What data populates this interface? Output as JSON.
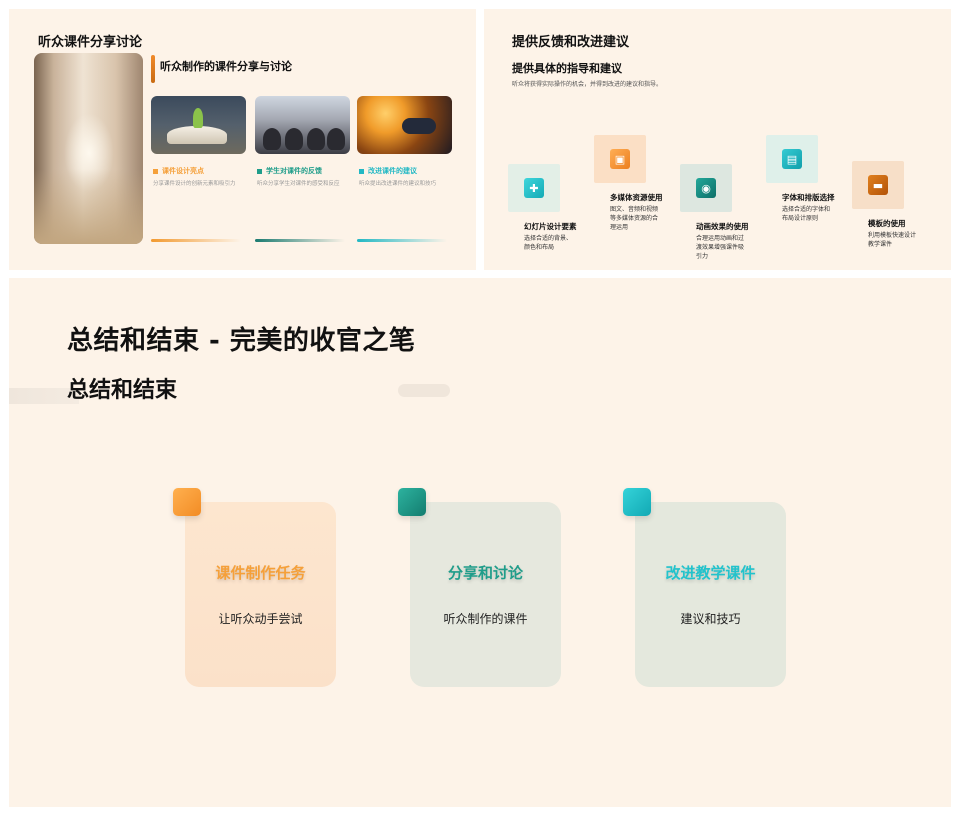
{
  "slide1": {
    "title": "听众课件分享讨论",
    "subtitle": "听众制作的课件分享与讨论",
    "cards": [
      {
        "label": "课件设计亮点",
        "desc": "分享课件设计的创新元素和吸引力",
        "color": "#f5a03a"
      },
      {
        "label": "学生对课件的反馈",
        "desc": "听众分享学生对课件的感受和反应",
        "color": "#1f9d8a"
      },
      {
        "label": "改进课件的建议",
        "desc": "听众提出改进课件的建议和技巧",
        "color": "#22b8c4"
      }
    ]
  },
  "slide2": {
    "title": "提供反馈和改进建议",
    "subtitle": "提供具体的指导和建议",
    "desc": "听众将获得实际操作的机会，并得到改进的建议和指导。",
    "steps": [
      {
        "title": "幻灯片设计要素",
        "desc": "选择合适的背景、颜色和布局",
        "icon": "puzzle-icon",
        "color": "#22c3cc"
      },
      {
        "title": "多媒体资源使用",
        "desc": "图文、音频和视频等多媒体资源的合理运用",
        "icon": "image-icon",
        "color": "#f5963a"
      },
      {
        "title": "动画效果的使用",
        "desc": "合理运用动画和过渡效果增强课件吸引力",
        "icon": "record-icon",
        "color": "#138a80"
      },
      {
        "title": "字体和排版选择",
        "desc": "选择合适的字体和布局设计原则",
        "icon": "monitor-icon",
        "color": "#20b5c2"
      },
      {
        "title": "模板的使用",
        "desc": "利用模板快速设计教学课件",
        "icon": "chat-icon",
        "color": "#c9640f"
      }
    ]
  },
  "slide3": {
    "title": "总结和结束 - 完美的收官之笔",
    "subtitle": "总结和结束",
    "cards": [
      {
        "title": "课件制作任务",
        "desc": "让听众动手尝试",
        "color": "#f5a03a"
      },
      {
        "title": "分享和讨论",
        "desc": "听众制作的课件",
        "color": "#1f9d8a"
      },
      {
        "title": "改进教学课件",
        "desc": "建议和技巧",
        "color": "#22c3cc"
      }
    ]
  }
}
